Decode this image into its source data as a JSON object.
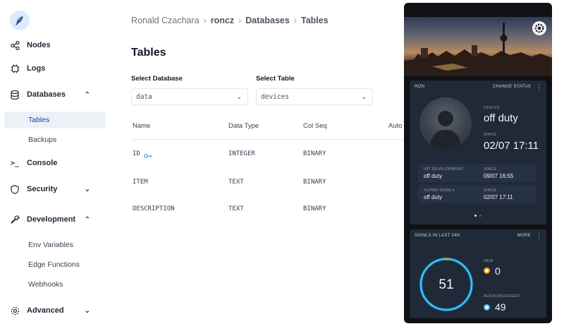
{
  "sidebar": {
    "items": [
      {
        "label": "Nodes",
        "icon": "nodes-icon"
      },
      {
        "label": "Logs",
        "icon": "logs-icon"
      },
      {
        "label": "Databases",
        "icon": "database-icon"
      },
      {
        "label": "Console",
        "icon": "console-icon"
      },
      {
        "label": "Security",
        "icon": "shield-icon"
      },
      {
        "label": "Development",
        "icon": "wrench-icon"
      },
      {
        "label": "Advanced",
        "icon": "gear-icon"
      }
    ],
    "database_subitems": [
      "Tables",
      "Backups"
    ],
    "development_subitems": [
      "Env Variables",
      "Edge Functions",
      "Webhooks"
    ]
  },
  "breadcrumb": [
    "Ronald Czachara",
    "roncz",
    "Databases",
    "Tables"
  ],
  "page_title": "Tables",
  "select_database": {
    "label": "Select Database",
    "value": "data"
  },
  "select_table": {
    "label": "Select Table",
    "value": "devices"
  },
  "table": {
    "columns": [
      "Name",
      "Data Type",
      "Col Seq",
      "Auto"
    ],
    "rows": [
      {
        "name": "ID",
        "type": "INTEGER",
        "seq": "BINARY",
        "key": true
      },
      {
        "name": "ITEM",
        "type": "TEXT",
        "seq": "BINARY",
        "key": false
      },
      {
        "name": "DESCRIPTION",
        "type": "TEXT",
        "seq": "BINARY",
        "key": false
      }
    ]
  },
  "phone": {
    "status_card": {
      "header": "RON",
      "change_status": "CHANGE STATUS",
      "status_label": "STATUS",
      "status_value": "off duty",
      "since_label": "SINCE",
      "since_value": "02/07 17:11",
      "rows": [
        {
          "name": "IOT DEVELOPMENT",
          "status": "off duty",
          "since_label": "SINCE",
          "since": "09/07 16:55"
        },
        {
          "name": "SUPER SIGNL4",
          "status": "off duty",
          "since_label": "SINCE",
          "since": "02/07 17:11"
        }
      ]
    },
    "signals_card": {
      "header": "SIGNLS IN LAST 24H",
      "more": "MORE",
      "total": "51",
      "new_label": "NEW",
      "new_value": "0",
      "ack_label": "ACKNOWLEDGED",
      "ack_value": "49"
    }
  },
  "colors": {
    "accent": "#38bdf8",
    "new_dot": "#f59e0b",
    "phone_bg": "#0f1114",
    "card_bg": "#1f2937"
  }
}
